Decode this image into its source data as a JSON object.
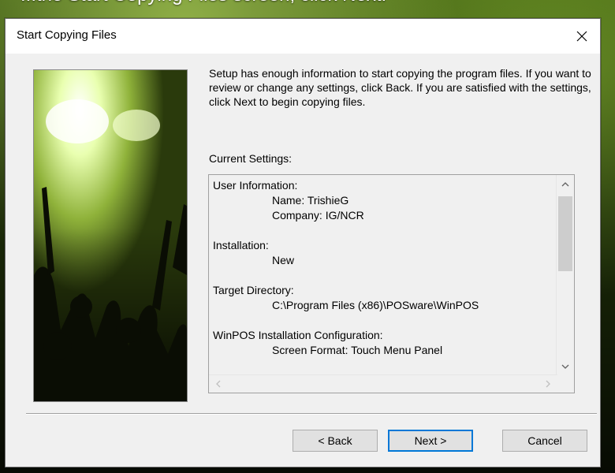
{
  "backdrop": {
    "caption": "...the Start Copying Files screen, click Next."
  },
  "window": {
    "title": "Start Copying Files",
    "close_icon": "close-icon"
  },
  "intro": {
    "text": "Setup has enough information to start copying the program files. If you want to review or change any settings, click Back.  If you are satisfied with the settings, click Next to begin copying files."
  },
  "settings": {
    "label": "Current Settings:",
    "lines": [
      {
        "text": "User Information:",
        "indent": false
      },
      {
        "text": "Name: TrishieG",
        "indent": true
      },
      {
        "text": "Company: IG/NCR",
        "indent": true
      },
      {
        "text": "",
        "indent": false
      },
      {
        "text": "Installation:",
        "indent": false
      },
      {
        "text": "New",
        "indent": true
      },
      {
        "text": "",
        "indent": false
      },
      {
        "text": "Target Directory:",
        "indent": false
      },
      {
        "text": "C:\\Program Files (x86)\\POSware\\WinPOS",
        "indent": true
      },
      {
        "text": "",
        "indent": false
      },
      {
        "text": "WinPOS Installation Configuration:",
        "indent": false
      },
      {
        "text": "Screen Format: Touch Menu Panel",
        "indent": true
      }
    ]
  },
  "buttons": {
    "back": "< Back",
    "next": "Next >",
    "cancel": "Cancel"
  }
}
